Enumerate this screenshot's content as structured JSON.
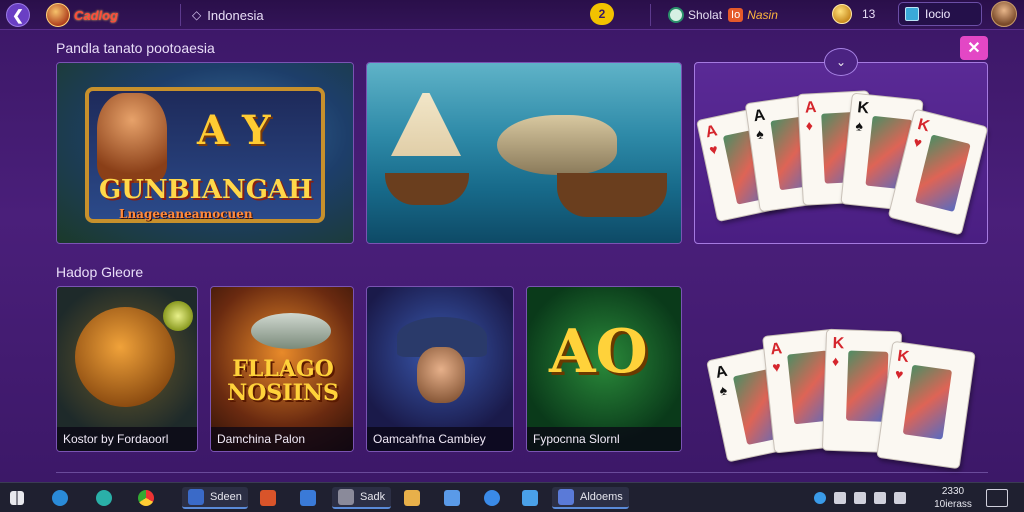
{
  "topbar": {
    "logo_text": "Cadlog",
    "region": "Indonesia",
    "notification_count": "2",
    "status_label": "Sholat",
    "status_badge": "Io",
    "status_name": "Nasin",
    "coin_amount": "13",
    "account_label": "Iocio"
  },
  "featured": {
    "title": "Pandla tanato pootoaesia",
    "tiles": [
      {
        "art_text_top": "A Y",
        "art_text_main": "GUNBIANGAH",
        "art_text_sub": "Lnageeaneamocuen"
      },
      {
        "art_text_main": ""
      },
      {
        "art_text_main": ""
      }
    ]
  },
  "popular": {
    "title": "Hadop Gleore",
    "tiles": [
      {
        "caption": "Kostor by Fordaoorl"
      },
      {
        "caption": "Damchina Palon",
        "art_text": "FLLAGO NOSIINS"
      },
      {
        "caption": "Oamcahfna Cambiey"
      },
      {
        "caption": "Fypocnna Slornl",
        "art_text": "AO"
      }
    ]
  },
  "cards_top": [
    {
      "rank": "A",
      "suit": "♥",
      "color": "red"
    },
    {
      "rank": "A",
      "suit": "♠",
      "color": "black"
    },
    {
      "rank": "A",
      "suit": "♦",
      "color": "red"
    },
    {
      "rank": "K",
      "suit": "♠",
      "color": "black"
    },
    {
      "rank": "K",
      "suit": "♥",
      "color": "red"
    }
  ],
  "cards_bottom": [
    {
      "rank": "A",
      "suit": "♠",
      "color": "black"
    },
    {
      "rank": "A",
      "suit": "♥",
      "color": "red"
    },
    {
      "rank": "K",
      "suit": "♦",
      "color": "red"
    },
    {
      "rank": "K",
      "suit": "♥",
      "color": "red"
    }
  ],
  "taskbar": {
    "apps": [
      {
        "label": "Sdeen"
      },
      {
        "label": "Sadk"
      },
      {
        "label": "Aldoems"
      }
    ],
    "clock_time": "2330",
    "clock_date": "10ierass"
  },
  "icons": {
    "back": "arrow-left-icon",
    "close": "close-icon",
    "scroll_up": "chevron-up-icon",
    "windows": "windows-icon"
  }
}
